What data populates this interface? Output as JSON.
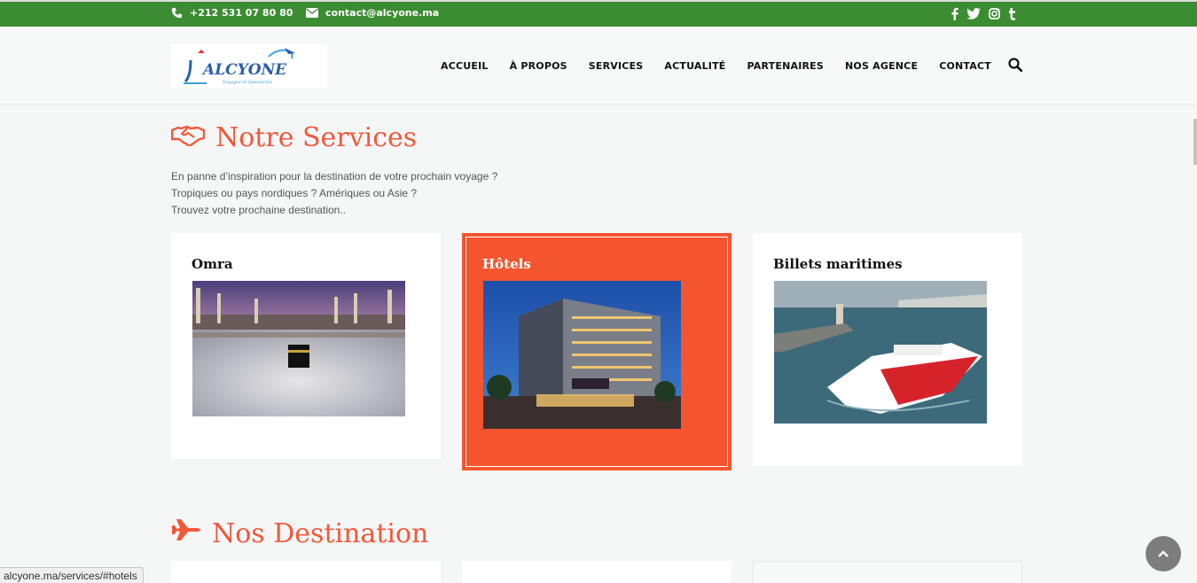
{
  "topbar": {
    "phone": "+212 531 07 80 80",
    "email": "contact@alcyone.ma",
    "phone_icon": "phone-icon",
    "email_icon": "envelope-icon",
    "social": [
      "facebook-icon",
      "twitter-icon",
      "instagram-icon",
      "tumblr-icon"
    ],
    "bg_color": "#3c8c32"
  },
  "header": {
    "logo_text": "ALCYONE",
    "logo_tagline": "Voyages et Spectacles",
    "nav": [
      "ACCUEIL",
      "À PROPOS",
      "SERVICES",
      "ACTUALITÉ",
      "PARTENAIRES",
      "NOS AGENCE",
      "CONTACT"
    ],
    "search_icon": "search-icon"
  },
  "services": {
    "title": "Notre Services",
    "icon": "handshake-icon",
    "intro": [
      "En panne d’inspiration pour la destination de votre prochain voyage ?",
      "Tropiques ou pays nordiques ? Amériques ou Asie ?",
      "Trouvez votre prochaine destination.."
    ],
    "cards": [
      {
        "title": "Omra",
        "image": "mecca-kaaba-photo"
      },
      {
        "title": "Hôtels",
        "image": "hotel-building-photo",
        "active": true
      },
      {
        "title": "Billets maritimes",
        "image": "ferry-ship-photo"
      }
    ],
    "accent_color": "#f2583a"
  },
  "destinations": {
    "title": "Nos Destination",
    "icon": "plane-icon"
  },
  "status_url": "alcyone.ma/services/#hotels",
  "back_to_top_icon": "chevron-up-icon"
}
